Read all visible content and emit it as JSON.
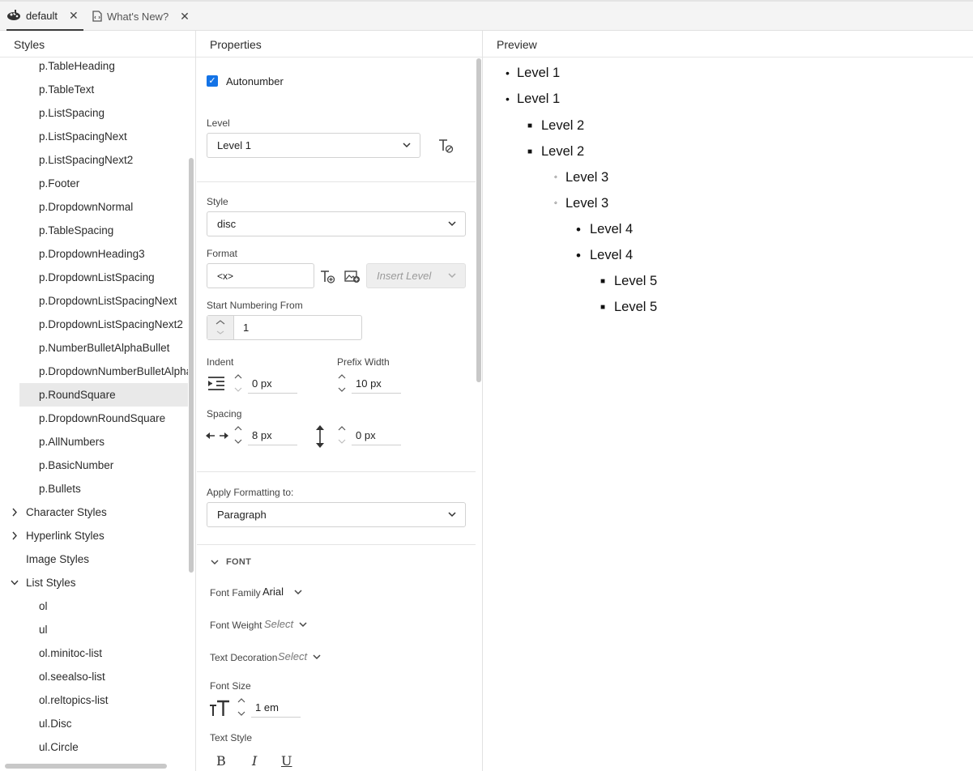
{
  "tabs": [
    {
      "label": "default",
      "close": "✕"
    },
    {
      "label": "What's New?",
      "close": "✕"
    }
  ],
  "panels": {
    "styles_title": "Styles",
    "properties_title": "Properties",
    "preview_title": "Preview"
  },
  "styles": {
    "paragraph_items": [
      "p.TableHeading",
      "p.TableText",
      "p.ListSpacing",
      "p.ListSpacingNext",
      "p.ListSpacingNext2",
      "p.Footer",
      "p.DropdownNormal",
      "p.TableSpacing",
      "p.DropdownHeading3",
      "p.DropdownListSpacing",
      "p.DropdownListSpacingNext",
      "p.DropdownListSpacingNext2",
      "p.NumberBulletAlphaBullet",
      "p.DropdownNumberBulletAlphaBullet",
      "p.RoundSquare",
      "p.DropdownRoundSquare",
      "p.AllNumbers",
      "p.BasicNumber",
      "p.Bullets"
    ],
    "selected": "p.RoundSquare",
    "categories": [
      {
        "label": "Character Styles",
        "chevron": "›"
      },
      {
        "label": "Hyperlink Styles",
        "chevron": "›"
      },
      {
        "label": "Image Styles",
        "chevron": ""
      },
      {
        "label": "List Styles",
        "chevron": "⌄"
      }
    ],
    "list_items": [
      "ol",
      "ul",
      "ol.minitoc-list",
      "ol.seealso-list",
      "ol.reltopics-list",
      "ul.Disc",
      "ul.Circle"
    ]
  },
  "properties": {
    "autonumber_label": "Autonumber",
    "autonumber_checked": true,
    "level_label": "Level",
    "level_value": "Level 1",
    "style_label": "Style",
    "style_value": "disc",
    "format_label": "Format",
    "format_value": "<x>",
    "insert_level_placeholder": "Insert Level",
    "start_numbering_label": "Start Numbering From",
    "start_numbering_value": "1",
    "indent_label": "Indent",
    "indent_value": "0 px",
    "prefix_width_label": "Prefix Width",
    "prefix_width_value": "10 px",
    "spacing_label": "Spacing",
    "spacing_horizontal_value": "8 px",
    "spacing_vertical_value": "0 px",
    "apply_formatting_label": "Apply Formatting to:",
    "apply_formatting_value": "Paragraph",
    "font_section_label": "FONT",
    "font_family_label": "Font Family",
    "font_family_value": "Arial",
    "font_weight_label": "Font Weight",
    "font_weight_value": "Select",
    "text_decoration_label": "Text Decoration",
    "text_decoration_value": "Select",
    "font_size_label": "Font Size",
    "font_size_value": "1 em",
    "text_style_label": "Text Style",
    "bold_label": "B",
    "italic_label": "I",
    "underline_label": "U"
  },
  "preview": {
    "items": [
      {
        "text": "Level 1",
        "bullet": "•"
      },
      {
        "text": "Level 1",
        "bullet": "•"
      },
      {
        "text": "Level 2",
        "bullet": "■"
      },
      {
        "text": "Level 2",
        "bullet": "■"
      },
      {
        "text": "Level 3",
        "bullet": "◦"
      },
      {
        "text": "Level 3",
        "bullet": "◦"
      },
      {
        "text": "Level 4",
        "bullet": "•"
      },
      {
        "text": "Level 4",
        "bullet": "•"
      },
      {
        "text": "Level 5",
        "bullet": "■"
      },
      {
        "text": "Level 5",
        "bullet": "■"
      }
    ]
  },
  "icons": {
    "default_tab": "theme-palette-icon",
    "whats_new_tab": "document-code-icon",
    "clear_format": "clear-formatting-icon",
    "add_text": "add-text-icon",
    "add_image": "add-image-icon",
    "indent": "indent-icon",
    "horizontal_spacing": "horizontal-spacing-icon",
    "vertical_spacing": "vertical-spacing-icon",
    "font_size": "font-size-icon"
  }
}
